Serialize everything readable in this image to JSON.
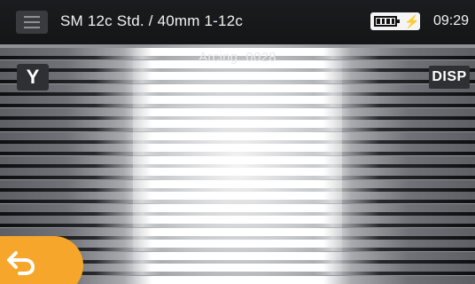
{
  "topbar": {
    "title": "SM 12c Std. / 40mm 1-12c",
    "time": "09:29",
    "menu_icon": "hamburger-menu-icon",
    "battery_icon": "battery-charging-icon"
  },
  "viewer": {
    "status_text": "Arcing..0028",
    "y_button_label": "Y",
    "disp_button_label": "DISP"
  },
  "footer": {
    "back_icon": "return-arrow-icon"
  },
  "colors": {
    "accent": "#f6a62a",
    "topbar": "#1b1c1f",
    "button_bg": "#2f3033"
  }
}
